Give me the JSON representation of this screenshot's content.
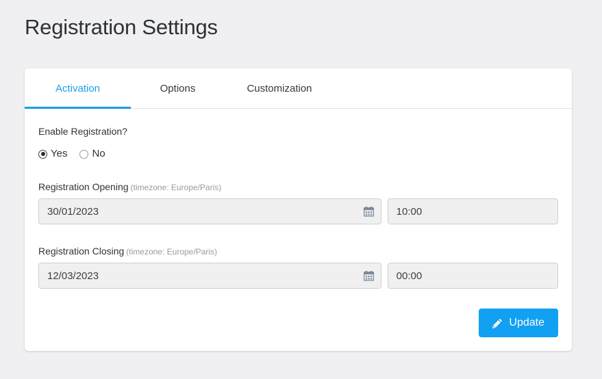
{
  "page": {
    "title": "Registration Settings",
    "background_color": "#f0f0f2",
    "accent_color": "#11a0f2"
  },
  "tabs": [
    {
      "label": "Activation",
      "active": true
    },
    {
      "label": "Options",
      "active": false
    },
    {
      "label": "Customization",
      "active": false
    }
  ],
  "form": {
    "enable_registration": {
      "label": "Enable Registration?",
      "options": [
        {
          "label": "Yes",
          "checked": true
        },
        {
          "label": "No",
          "checked": false
        }
      ]
    },
    "opening": {
      "label": "Registration Opening",
      "timezone_note": "(timezone: Europe/Paris)",
      "date_value": "30/01/2023",
      "time_value": "10:00",
      "date_icon": "calendar-icon"
    },
    "closing": {
      "label": "Registration Closing",
      "timezone_note": "(timezone: Europe/Paris)",
      "date_value": "12/03/2023",
      "time_value": "00:00",
      "date_icon": "calendar-icon"
    }
  },
  "footer": {
    "update_label": "Update",
    "update_icon": "pencil-icon"
  }
}
